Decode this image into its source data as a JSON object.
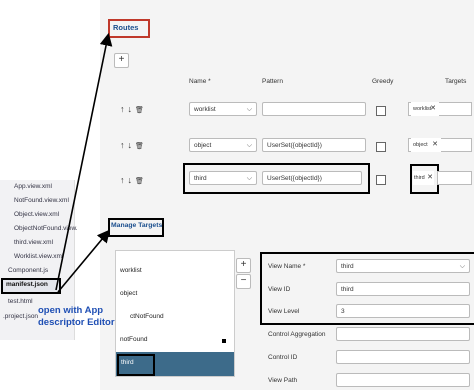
{
  "routes": {
    "title": "Routes",
    "add_label": "+",
    "columns": {
      "name": "Name *",
      "pattern": "Pattern",
      "greedy": "Greedy",
      "targets": "Targets"
    },
    "rows": [
      {
        "name": "worklist",
        "pattern": "",
        "target": "worklist"
      },
      {
        "name": "object",
        "pattern": "UserSet({objectId})",
        "target": "object"
      },
      {
        "name": "third",
        "pattern": "UserSet({objectId})",
        "target": "third"
      }
    ],
    "row_icons": {
      "up": "↑",
      "down": "↓",
      "delete": "🗑"
    },
    "chevron": "⌵",
    "token_remove": "✕"
  },
  "file_tree": {
    "items": [
      "App.view.xml",
      "NotFound.view.xml",
      "Object.view.xml",
      "ObjectNotFound.view.",
      "third.view.xml",
      "Worklist.view.xml",
      "Component.js",
      "manifest.json",
      "test.html",
      ".project.json"
    ]
  },
  "manage_targets": {
    "title": "Manage Targets",
    "add_label": "+",
    "remove_label": "−",
    "targets": [
      "worklist",
      "object",
      "ctNotFound",
      "notFound",
      "third"
    ],
    "selected_index": 4,
    "form": {
      "view_name_label": "View Name *",
      "view_name_value": "third",
      "view_id_label": "View ID",
      "view_id_value": "third",
      "view_level_label": "View Level",
      "view_level_value": "3",
      "control_aggregation_label": "Control Aggregation",
      "control_id_label": "Control ID",
      "view_path_label": "View Path"
    }
  },
  "annotation": {
    "line1": "open with App",
    "line2": "descriptor Editor"
  },
  "colors": {
    "selected_row": "#3d6b8a",
    "highlight_red": "#c0392b",
    "annotation_blue": "#1f4fb4",
    "title_blue": "#1b4f8e"
  }
}
